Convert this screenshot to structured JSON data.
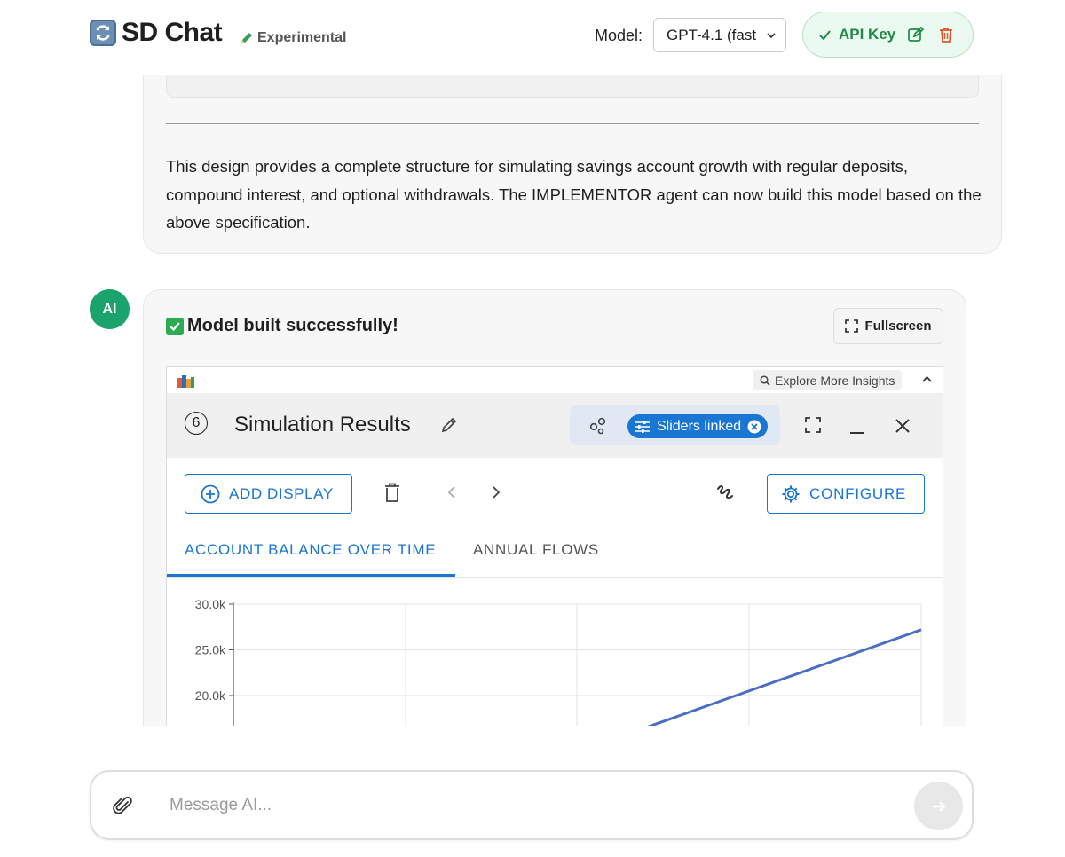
{
  "header": {
    "app_title": "SD Chat",
    "experimental_label": "Experimental",
    "model_label": "Model:",
    "model_selected": "GPT-4.1 (fast",
    "api_key_label": "API Key"
  },
  "previous_message": {
    "text": "This design provides a complete structure for simulating savings account growth with regular deposits, compound interest, and optional withdrawals. The IMPLEMENTOR agent can now build this model based on the above specification."
  },
  "ai_message": {
    "avatar_label": "AI",
    "status_text": "Model built successfully!",
    "fullscreen_label": "Fullscreen"
  },
  "widget": {
    "explore_label": "Explore More Insights",
    "panel_number": "⑥",
    "panel_title": "Simulation Results",
    "sliders_chip_label": "Sliders linked",
    "add_display_label": "ADD DISPLAY",
    "configure_label": "CONFIGURE",
    "tabs": [
      {
        "label": "ACCOUNT BALANCE OVER TIME",
        "active": true
      },
      {
        "label": "ANNUAL FLOWS",
        "active": false
      }
    ]
  },
  "chart_data": {
    "type": "line",
    "title": "",
    "xlabel": "",
    "ylabel": "",
    "y_ticks": [
      "30.0k",
      "25.0k",
      "20.0k"
    ],
    "ylim": [
      15000,
      30000
    ],
    "grid": true,
    "series": [
      {
        "x": [
          0.6,
          1.0
        ],
        "values": [
          16500,
          27200
        ],
        "color": "#4a6fc2"
      }
    ],
    "xlim": [
      0,
      1
    ]
  },
  "composer": {
    "placeholder": "Message AI..."
  },
  "colors": {
    "accent": "#1976d2",
    "success": "#1aa36a",
    "api_green": "#1f8a43",
    "delete_red": "#e2562c"
  }
}
